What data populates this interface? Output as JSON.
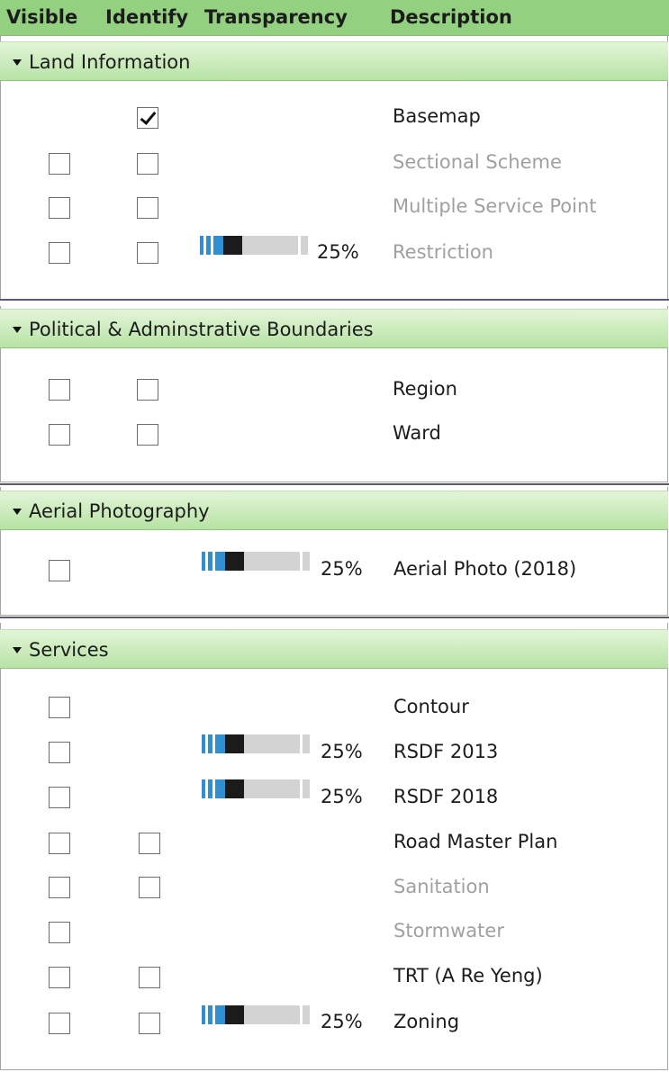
{
  "columns": {
    "visible": "Visible",
    "identify": "Identify",
    "transparency": "Transparency",
    "description": "Description"
  },
  "colors": {
    "header": "#93d181",
    "group_bar": "#b7e3a4",
    "slider_fill": "#2f8fd0",
    "slider_handle": "#1b1b1b",
    "dim_text": "#a0a0a0"
  },
  "groups": [
    {
      "title": "Land Information",
      "layers": [
        {
          "description": "Basemap",
          "visible": null,
          "identify": true,
          "transparency": null,
          "enabled": true
        },
        {
          "description": "Sectional Scheme",
          "visible": false,
          "identify": false,
          "transparency": null,
          "enabled": false
        },
        {
          "description": "Multiple Service Point",
          "visible": false,
          "identify": false,
          "transparency": null,
          "enabled": false
        },
        {
          "description": "Restriction",
          "visible": false,
          "identify": false,
          "transparency": "25%",
          "transparency_value": 0.25,
          "enabled": false
        }
      ]
    },
    {
      "title": "Political & Adminstrative Boundaries",
      "layers": [
        {
          "description": "Region",
          "visible": false,
          "identify": false,
          "transparency": null,
          "enabled": true
        },
        {
          "description": "Ward",
          "visible": false,
          "identify": false,
          "transparency": null,
          "enabled": true
        }
      ]
    },
    {
      "title": "Aerial Photography",
      "layers": [
        {
          "description": "Aerial Photo (2018)",
          "visible": false,
          "identify": null,
          "transparency": "25%",
          "transparency_value": 0.25,
          "enabled": true
        }
      ]
    },
    {
      "title": "Services",
      "layers": [
        {
          "description": "Contour",
          "visible": false,
          "identify": null,
          "transparency": null,
          "enabled": true
        },
        {
          "description": "RSDF 2013",
          "visible": false,
          "identify": null,
          "transparency": "25%",
          "transparency_value": 0.25,
          "enabled": true
        },
        {
          "description": "RSDF 2018",
          "visible": false,
          "identify": null,
          "transparency": "25%",
          "transparency_value": 0.25,
          "enabled": true
        },
        {
          "description": "Road Master Plan",
          "visible": false,
          "identify": false,
          "transparency": null,
          "enabled": true
        },
        {
          "description": "Sanitation",
          "visible": false,
          "identify": false,
          "transparency": null,
          "enabled": false
        },
        {
          "description": "Stormwater",
          "visible": false,
          "identify": null,
          "transparency": null,
          "enabled": false
        },
        {
          "description": "TRT (A Re Yeng)",
          "visible": false,
          "identify": false,
          "transparency": null,
          "enabled": true
        },
        {
          "description": "Zoning",
          "visible": false,
          "identify": false,
          "transparency": "25%",
          "transparency_value": 0.25,
          "enabled": true
        }
      ]
    }
  ]
}
